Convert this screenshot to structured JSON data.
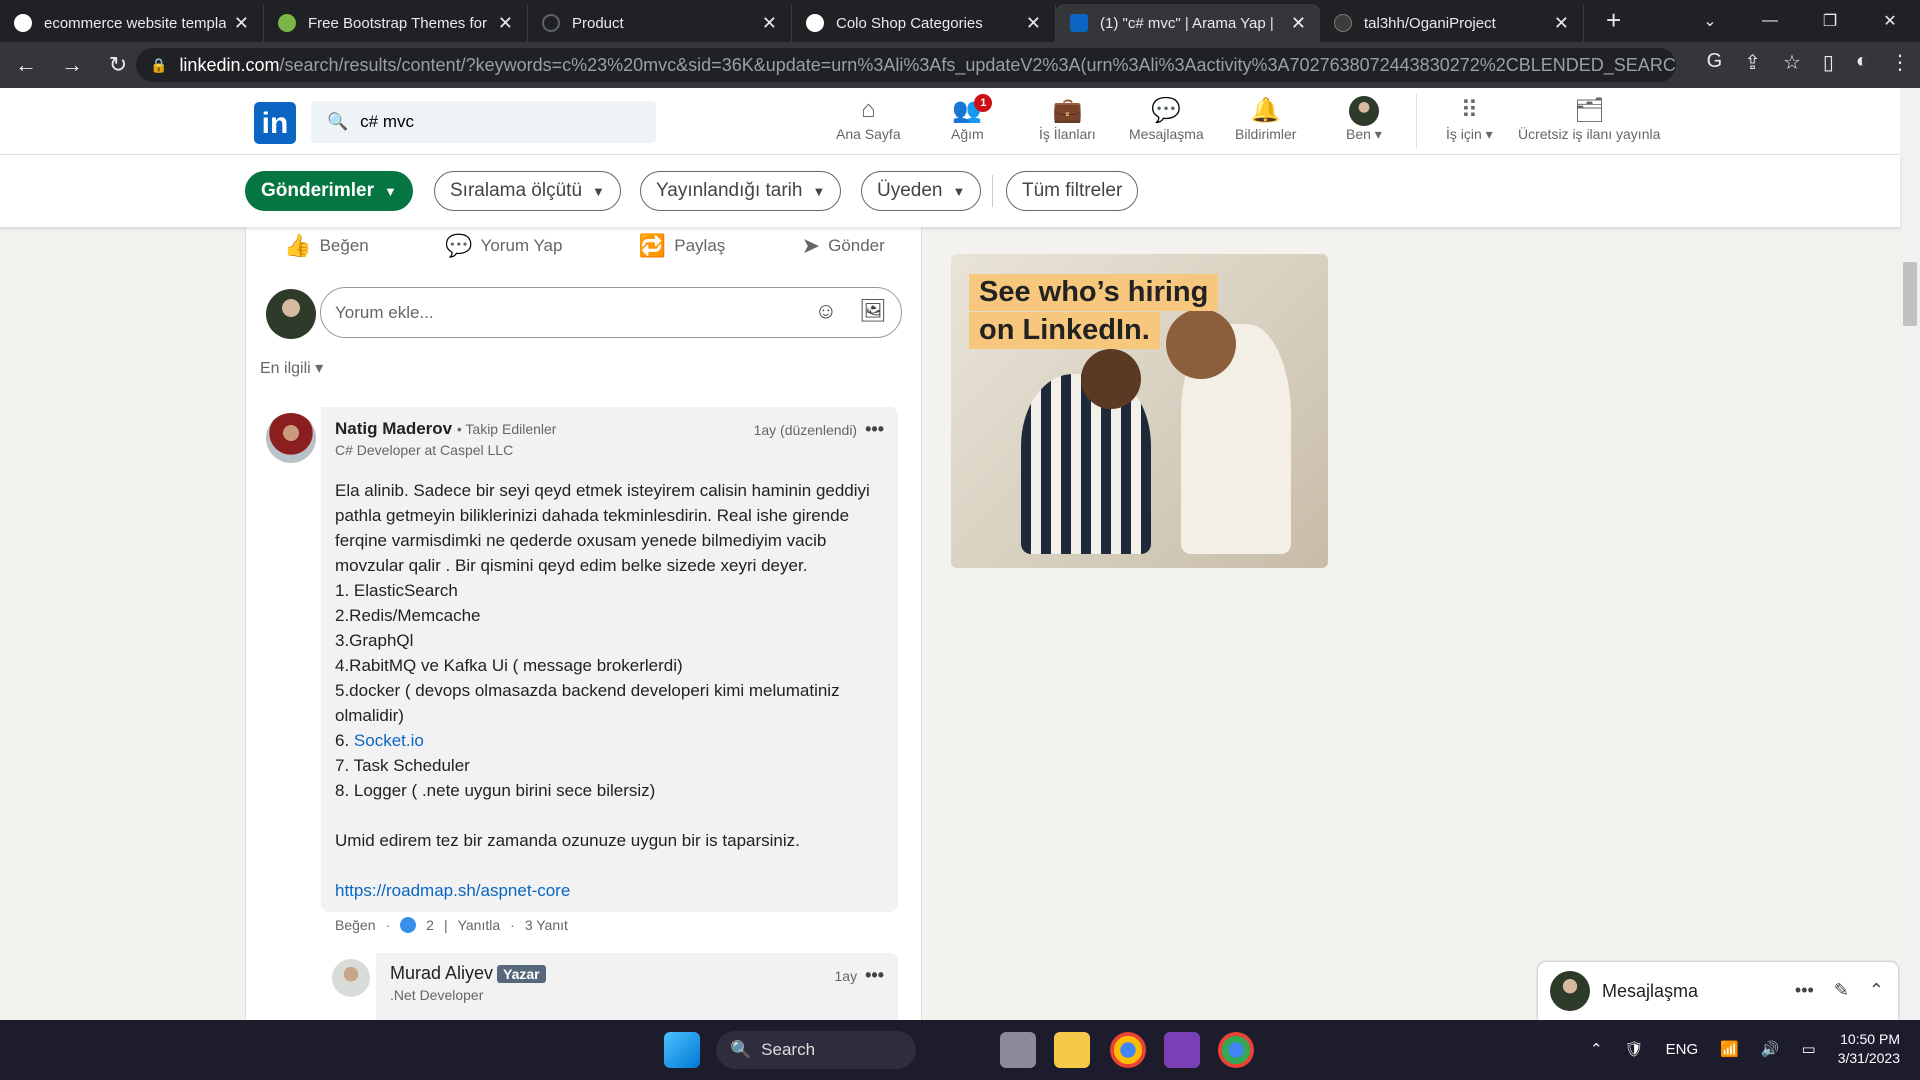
{
  "browser": {
    "tabs": [
      {
        "title": "ecommerce website templa",
        "favicon_color": "#ffffff",
        "active": false
      },
      {
        "title": "Free Bootstrap Themes for",
        "favicon_color": "#7ab648",
        "active": false
      },
      {
        "title": "Product",
        "favicon_color": "#5f6368",
        "active": false
      },
      {
        "title": "Colo Shop Categories",
        "favicon_color": "#ffffff",
        "active": false
      },
      {
        "title": "(1) \"c# mvc\" | Arama Yap |",
        "favicon_color": "#0a66c2",
        "active": true
      },
      {
        "title": "tal3hh/OganiProject",
        "favicon_color": "#3c3c3c",
        "active": false
      }
    ],
    "url_host": "linkedin.com",
    "url_path": "/search/results/content/?keywords=c%23%20mvc&sid=36K&update=urn%3Ali%3Afs_updateV2%3A(urn%3Ali%3Aactivity%3A7027638072443830272%2CBLENDED_SEARCH_FEE..."
  },
  "linkedin": {
    "logo": "in",
    "search_value": "c# mvc",
    "nav": [
      {
        "label": "Ana Sayfa",
        "icon": "home-icon",
        "glyph": "⌂"
      },
      {
        "label": "Ağım",
        "icon": "network-icon",
        "glyph": "👥",
        "badge": "1"
      },
      {
        "label": "İş İlanları",
        "icon": "jobs-icon",
        "glyph": "💼"
      },
      {
        "label": "Mesajlaşma",
        "icon": "messaging-icon",
        "glyph": "💬"
      },
      {
        "label": "Bildirimler",
        "icon": "notifications-icon",
        "glyph": "🔔"
      },
      {
        "label": "Ben ▾",
        "icon": "profile-avatar",
        "glyph": ""
      },
      {
        "label": "İş için ▾",
        "icon": "grid-icon",
        "glyph": "⋮⋮⋮"
      },
      {
        "label": "Ücretsiz iş ilanı yayınla",
        "icon": "post-job-icon",
        "glyph": "🗂"
      }
    ],
    "filters": {
      "posts": "Gönderimler",
      "sort": "Sıralama ölçütü",
      "date": "Yayınlandığı tarih",
      "member": "Üyeden",
      "all": "Tüm filtreler"
    },
    "actions": {
      "like": "Beğen",
      "comment": "Yorum Yap",
      "share": "Paylaş",
      "send": "Gönder"
    },
    "comment_placeholder": "Yorum ekle...",
    "sort_label": "En ilgili",
    "comment": {
      "name": "Natig Maderov",
      "follow": "• Takip Edilenler",
      "title": "C# Developer at Caspel LLC",
      "time": "1ay (düzenlendi)",
      "body_lines": [
        "Ela alinib. Sadece bir seyi qeyd etmek isteyirem calisin haminin geddiyi",
        "pathla getmeyin biliklerinizi dahada tekminlesdirin. Real ishe girende",
        "ferqine varmisdimki ne qederde oxusam yenede bilmediyim vacib",
        "movzular qalir . Bir qismini qeyd edim belke sizede xeyri deyer.",
        "1. ElasticSearch",
        "2.Redis/Memcache",
        "3.GraphQl",
        "4.RabitMQ ve Kafka Ui ( message brokerlerdi)",
        "5.docker ( devops olmasazda backend developeri kimi melumatiniz",
        "olmalidir)"
      ],
      "item6_prefix": "6. ",
      "item6_link": "Socket.io",
      "body_lines_2": [
        "7. Task Scheduler",
        "8. Logger ( .nete uygun birini sece bilersiz)",
        "",
        "Umid edirem tez bir zamanda ozunuze uygun bir is taparsiniz.",
        ""
      ],
      "link": "https://roadmap.sh/aspnet-core",
      "like": "Beğen",
      "reactions": "2",
      "reply": "Yanıtla",
      "replies": "3 Yanıt"
    },
    "reply": {
      "name": "Murad Aliyev",
      "badge": "Yazar",
      "title": ".Net Developer",
      "time": "1ay"
    },
    "ad": {
      "line1": "See who’s hiring",
      "line2": "on LinkedIn."
    },
    "messaging": "Mesajlaşma"
  },
  "taskbar": {
    "search": "Search",
    "lang": "ENG",
    "time": "10:50 PM",
    "date": "3/31/2023"
  }
}
